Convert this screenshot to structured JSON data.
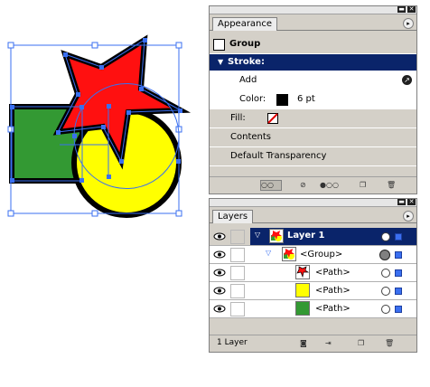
{
  "appearance": {
    "title": "Appearance",
    "object_label": "Group",
    "stroke_label": "Stroke:",
    "add_label": "Add",
    "color_label": "Color:",
    "stroke_weight": "6 pt",
    "fill_label": "Fill:",
    "contents_label": "Contents",
    "transparency_label": "Default Transparency"
  },
  "layers": {
    "title": "Layers",
    "items": [
      {
        "name": "Layer 1"
      },
      {
        "name": "<Group>"
      },
      {
        "name": "<Path>"
      },
      {
        "name": "<Path>"
      },
      {
        "name": "<Path>"
      }
    ],
    "count_label": "1 Layer"
  },
  "colors": {
    "star_fill": "#ff1010",
    "circle_fill": "#ffff00",
    "rect_fill": "#339933",
    "stroke": "#000000",
    "selection": "#3a6ff0",
    "active_row": "#0a246a",
    "panel_bg": "#d4d0c8"
  },
  "icons": [
    "eye-icon",
    "triangle-down-icon",
    "star-thumbnail-icon",
    "circle-thumbnail-icon",
    "rect-thumbnail-icon",
    "new-layer-icon",
    "trash-icon",
    "options-menu-icon"
  ]
}
